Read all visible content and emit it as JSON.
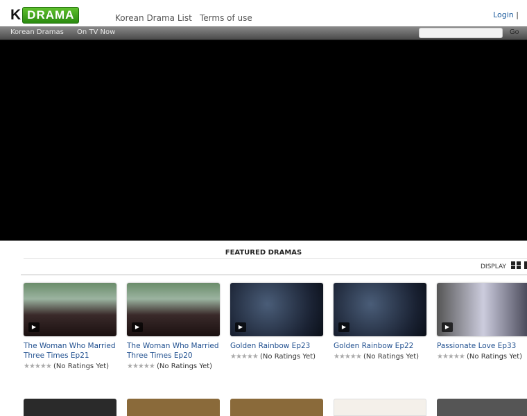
{
  "header": {
    "logo_k": "K",
    "logo_drama": "DRAMA",
    "links": [
      "Korean Drama List",
      "Terms of use"
    ],
    "login": "Login",
    "sep": "|"
  },
  "nav": {
    "items": [
      "Korean Dramas",
      "On TV Now"
    ],
    "search_placeholder": "",
    "go": "Go"
  },
  "featured": {
    "title": "FEATURED DRAMAS",
    "display_label": "DISPLAY",
    "items": [
      {
        "title": "The Woman Who Married Three Times Ep21",
        "rating": "(No Ratings Yet)"
      },
      {
        "title": "The Woman Who Married Three Times Ep20",
        "rating": "(No Ratings Yet)"
      },
      {
        "title": "Golden Rainbow Ep23",
        "rating": "(No Ratings Yet)"
      },
      {
        "title": "Golden Rainbow Ep22",
        "rating": "(No Ratings Yet)"
      },
      {
        "title": "Passionate Love Ep33",
        "rating": "(No Ratings Yet)"
      }
    ],
    "stars": "★★★★★"
  }
}
